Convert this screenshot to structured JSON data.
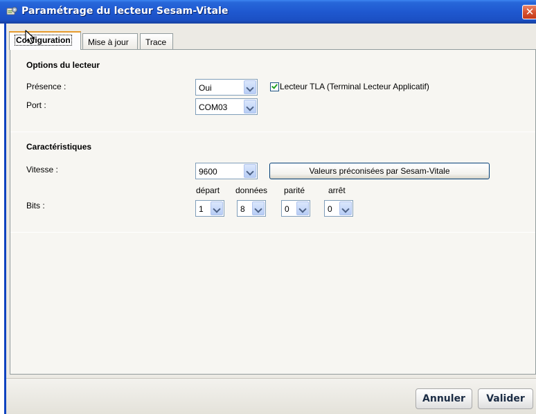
{
  "window": {
    "title": "Paramétrage du lecteur Sesam-Vitale",
    "close_glyph": "✕"
  },
  "tabs": [
    {
      "label": "Configuration",
      "active": true
    },
    {
      "label": "Mise à jour",
      "active": false
    },
    {
      "label": "Trace",
      "active": false
    }
  ],
  "options": {
    "section_title": "Options du lecteur",
    "presence_label": "Présence :",
    "presence_value": "Oui",
    "tla_checkbox_label": "Lecteur TLA (Terminal Lecteur Applicatif)",
    "tla_checked": true,
    "port_label": "Port :",
    "port_value": "COM03"
  },
  "characteristics": {
    "section_title": "Caractéristiques",
    "speed_label": "Vitesse :",
    "speed_value": "9600",
    "defaults_button": "Valeurs préconisées par Sesam-Vitale",
    "bits_label": "Bits :",
    "bits": [
      {
        "header": "départ",
        "value": "1"
      },
      {
        "header": "données",
        "value": "8"
      },
      {
        "header": "parité",
        "value": "0"
      },
      {
        "header": "arrêt",
        "value": "0"
      }
    ]
  },
  "footer": {
    "cancel_label": "Annuler",
    "validate_label": "Valider"
  },
  "colors": {
    "titlebar": "#1f58d0",
    "close_button": "#d8532f",
    "active_tab_accent": "#e69a2c",
    "checkmark": "#21a121"
  },
  "icons": {
    "app": "settings-gear-icon",
    "close": "close-icon",
    "dropdown": "chevron-down-icon",
    "cursor": "mouse-pointer-icon"
  }
}
